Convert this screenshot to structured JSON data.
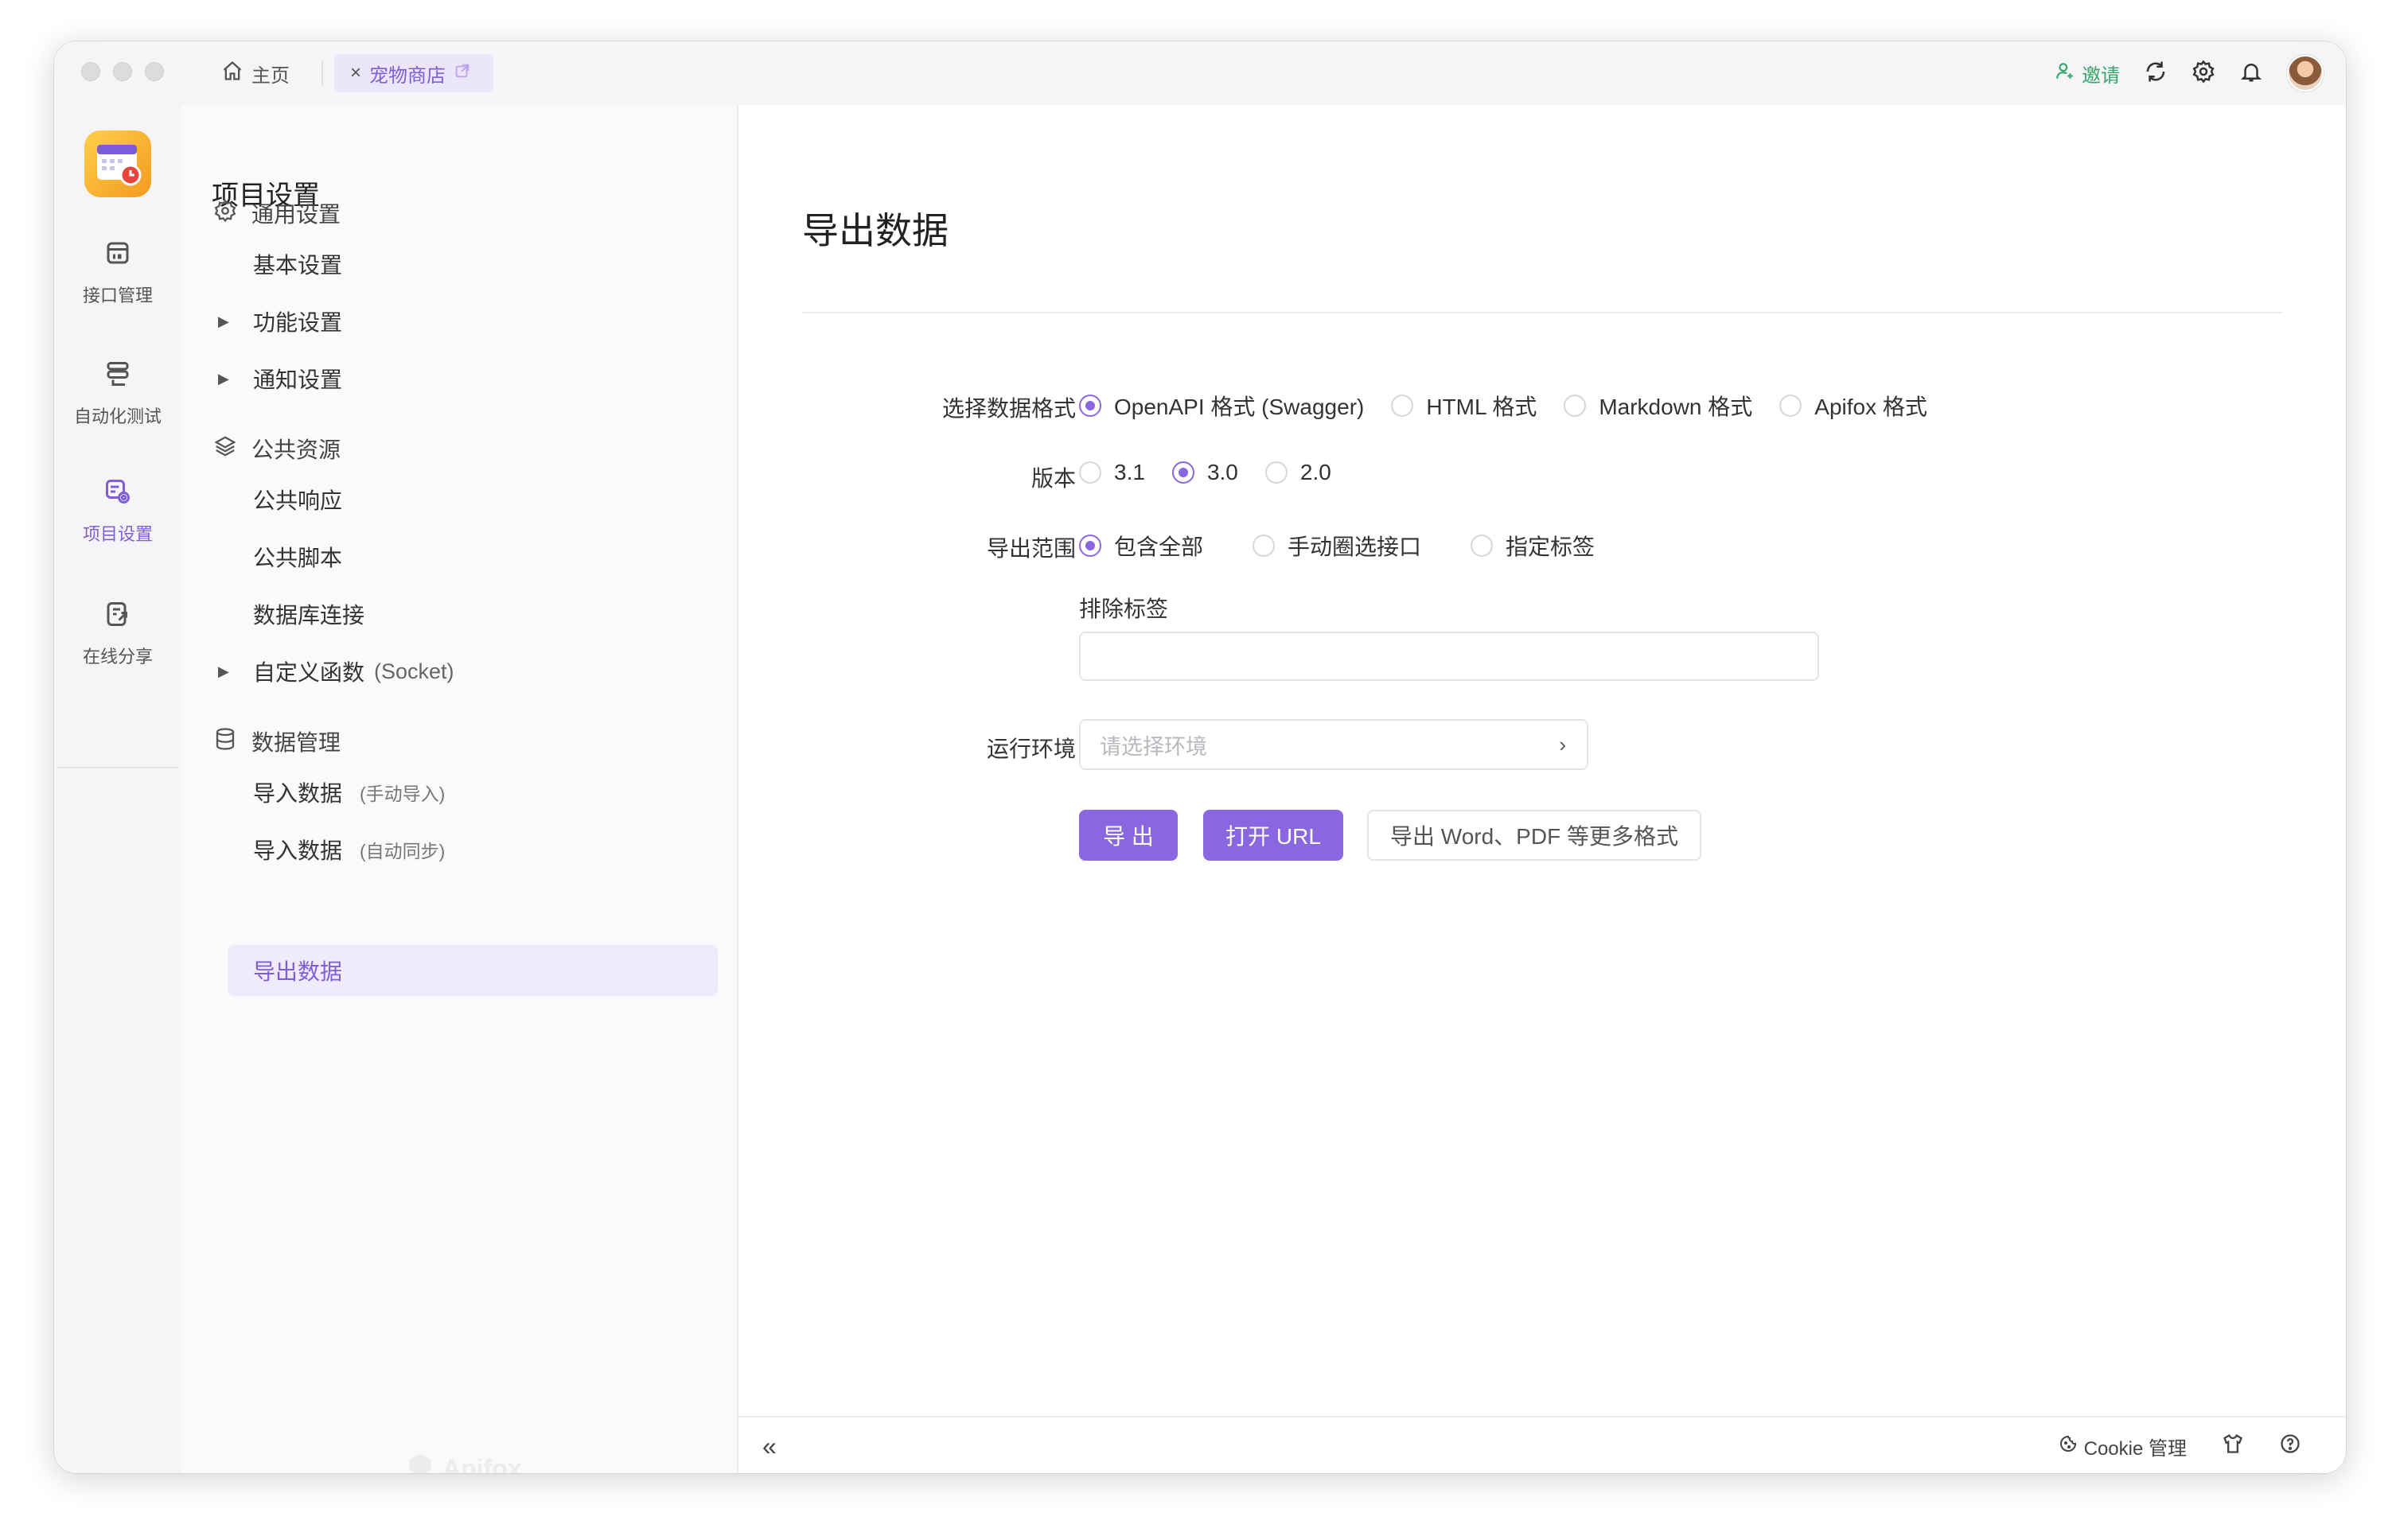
{
  "titlebar": {
    "home_tab": "主页",
    "active_tab": "宠物商店",
    "invite": "邀请"
  },
  "rail": {
    "items": [
      {
        "label": "接口管理",
        "icon": "api-management-icon"
      },
      {
        "label": "自动化测试",
        "icon": "automation-test-icon"
      },
      {
        "label": "项目设置",
        "icon": "project-settings-icon"
      },
      {
        "label": "在线分享",
        "icon": "online-share-icon"
      }
    ]
  },
  "nav": {
    "title": "项目设置",
    "general_group": "通用设置",
    "basic": "基本设置",
    "feature": "功能设置",
    "notify": "通知设置",
    "resources_group": "公共资源",
    "common_response": "公共响应",
    "common_script": "公共脚本",
    "db_connection": "数据库连接",
    "custom_function": "自定义函数",
    "custom_function_hint": "(Socket)",
    "data_group": "数据管理",
    "import_manual": "导入数据",
    "import_manual_hint": "(手动导入)",
    "import_auto": "导入数据",
    "import_auto_hint": "(自动同步)",
    "export": "导出数据",
    "watermark": "Apifox"
  },
  "main": {
    "title": "导出数据",
    "format_label": "选择数据格式",
    "formats": [
      "OpenAPI 格式 (Swagger)",
      "HTML 格式",
      "Markdown 格式",
      "Apifox 格式"
    ],
    "format_selected": "OpenAPI 格式 (Swagger)",
    "version_label": "版本",
    "versions": [
      "3.1",
      "3.0",
      "2.0"
    ],
    "version_selected": "3.0",
    "scope_label": "导出范围",
    "scopes": [
      "包含全部",
      "手动圈选接口",
      "指定标签"
    ],
    "scope_selected": "包含全部",
    "exclude_tags_label": "排除标签",
    "exclude_tags_value": "",
    "env_label": "运行环境",
    "env_placeholder": "请选择环境",
    "export_button": "导 出",
    "open_url_button": "打开 URL",
    "more_formats_button": "导出 Word、PDF 等更多格式"
  },
  "footer": {
    "cookie": "Cookie 管理"
  },
  "colors": {
    "accent": "#8a67e0",
    "invite": "#3aa46b"
  }
}
